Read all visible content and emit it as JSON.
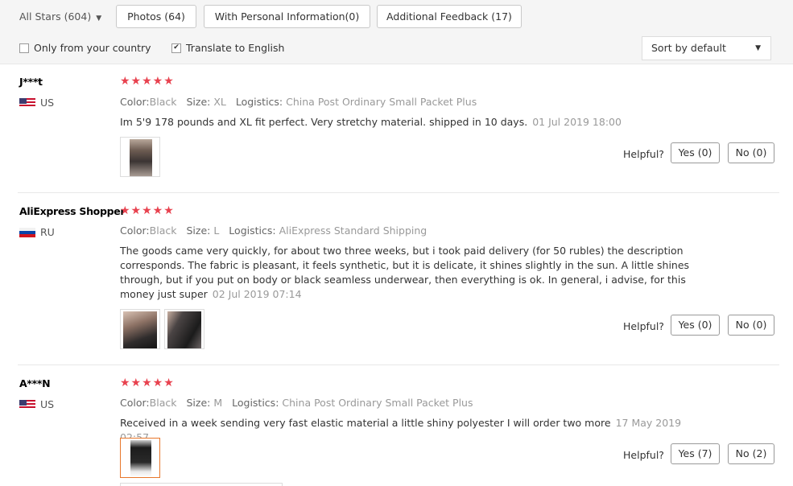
{
  "filters": {
    "stars_dropdown": "All Stars (604)",
    "buttons": [
      "Photos (64)",
      "With Personal Information(0)",
      "Additional Feedback (17)"
    ],
    "only_country": {
      "label": "Only from your country",
      "checked": false
    },
    "translate": {
      "label": "Translate to English",
      "checked": true
    },
    "sort": "Sort by default"
  },
  "helpful_label": "Helpful?",
  "meta_labels": {
    "color": "Color:",
    "size": "Size:",
    "logistics": "Logistics:"
  },
  "reviews": [
    {
      "user": "J***t",
      "country": "US",
      "stars": "★★★★★",
      "rating": 5,
      "color": "Black",
      "size": "XL",
      "logistics": "China Post Ordinary Small Packet Plus",
      "text": "Im 5'9 178 pounds and XL fit perfect. Very stretchy material. shipped in 10 days.",
      "date": "01 Jul 2019 18:00",
      "yes": "Yes (0)",
      "no": "No (0)"
    },
    {
      "user": "AliExpress Shopper",
      "country": "RU",
      "stars": "★★★★★",
      "rating": 5,
      "color": "Black",
      "size": "L",
      "logistics": "AliExpress Standard Shipping",
      "text": "The goods came very quickly, for about two three weeks, but i took paid delivery (for 50 rubles) the description corresponds. The fabric is pleasant, it feels synthetic, but it is delicate, it shines slightly in the sun. A little shines through, but if you put on body or black seamless underwear, then everything is ok. In general, i advise, for this money just super",
      "date": "02 Jul 2019 07:14",
      "yes": "Yes (0)",
      "no": "No (0)"
    },
    {
      "user": "A***N",
      "country": "US",
      "stars": "★★★★★",
      "rating": 5,
      "color": "Black",
      "size": "M",
      "logistics": "China Post Ordinary Small Packet Plus",
      "text": "Received in a week sending very fast elastic material a little shiny polyester I will order two more",
      "date": "17 May 2019 02:57",
      "yes": "Yes (7)",
      "no": "No (2)"
    }
  ]
}
